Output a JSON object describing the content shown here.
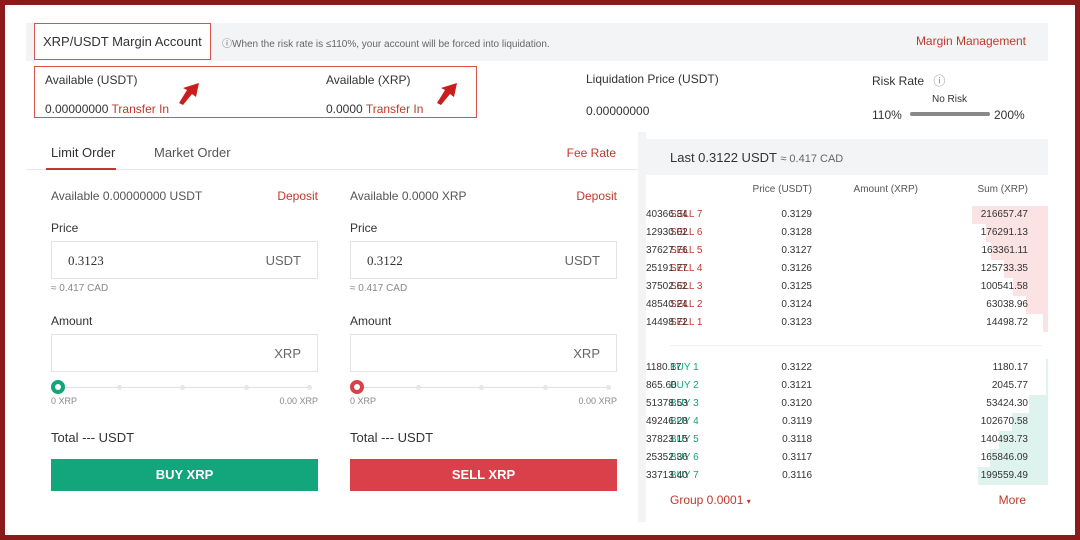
{
  "header": {
    "title": "XRP/USDT Margin Account",
    "warning": "When the risk rate is ≤110%, your account will be forced into liquidation.",
    "margin_management": "Margin Management"
  },
  "summary": {
    "available_usdt_label": "Available (USDT)",
    "available_usdt_value": "0.00000000",
    "available_xrp_label": "Available (XRP)",
    "available_xrp_value": "0.0000",
    "transfer_in": "Transfer In",
    "liquidation_label": "Liquidation Price (USDT)",
    "liquidation_value": "0.00000000",
    "risk_label": "Risk Rate",
    "risk_status": "No Risk",
    "risk_min": "110%",
    "risk_max": "200%"
  },
  "order_tabs": {
    "limit": "Limit Order",
    "market": "Market Order",
    "fee_rate": "Fee Rate"
  },
  "buy_form": {
    "available": "Available 0.00000000 USDT",
    "deposit": "Deposit",
    "price_label": "Price",
    "price_value": "0.3123",
    "price_unit": "USDT",
    "cad_equiv": "≈ 0.417 CAD",
    "amount_label": "Amount",
    "amount_unit": "XRP",
    "slider_min": "0 XRP",
    "slider_max": "0.00 XRP",
    "total": "Total --- USDT",
    "button": "BUY XRP"
  },
  "sell_form": {
    "available": "Available 0.0000 XRP",
    "deposit": "Deposit",
    "price_label": "Price",
    "price_value": "0.3122",
    "price_unit": "USDT",
    "cad_equiv": "≈ 0.417 CAD",
    "amount_label": "Amount",
    "amount_unit": "XRP",
    "slider_min": "0 XRP",
    "slider_max": "0.00 XRP",
    "total": "Total --- USDT",
    "button": "SELL XRP"
  },
  "orderbook": {
    "last": "Last 0.3122 USDT",
    "last_cad": "≈ 0.417 CAD",
    "col_price": "Price (USDT)",
    "col_amount": "Amount (XRP)",
    "col_sum": "Sum (XRP)",
    "max_sum": 216657.47,
    "sells": [
      {
        "side": "SELL 7",
        "price": "0.3129",
        "amount": "40366.34",
        "sum": "216657.47",
        "sum_value": 216657.47
      },
      {
        "side": "SELL 6",
        "price": "0.3128",
        "amount": "12930.02",
        "sum": "176291.13",
        "sum_value": 176291.13
      },
      {
        "side": "SELL 5",
        "price": "0.3127",
        "amount": "37627.76",
        "sum": "163361.11",
        "sum_value": 163361.11
      },
      {
        "side": "SELL 4",
        "price": "0.3126",
        "amount": "25191.77",
        "sum": "125733.35",
        "sum_value": 125733.35
      },
      {
        "side": "SELL 3",
        "price": "0.3125",
        "amount": "37502.62",
        "sum": "100541.58",
        "sum_value": 100541.58
      },
      {
        "side": "SELL 2",
        "price": "0.3124",
        "amount": "48540.24",
        "sum": "63038.96",
        "sum_value": 63038.96
      },
      {
        "side": "SELL 1",
        "price": "0.3123",
        "amount": "14498.72",
        "sum": "14498.72",
        "sum_value": 14498.72
      }
    ],
    "buys": [
      {
        "side": "BUY 1",
        "price": "0.3122",
        "amount": "1180.17",
        "sum": "1180.17",
        "sum_value": 1180.17
      },
      {
        "side": "BUY 2",
        "price": "0.3121",
        "amount": "865.60",
        "sum": "2045.77",
        "sum_value": 2045.77
      },
      {
        "side": "BUY 3",
        "price": "0.3120",
        "amount": "51378.53",
        "sum": "53424.30",
        "sum_value": 53424.3
      },
      {
        "side": "BUY 4",
        "price": "0.3119",
        "amount": "49246.28",
        "sum": "102670.58",
        "sum_value": 102670.58
      },
      {
        "side": "BUY 5",
        "price": "0.3118",
        "amount": "37823.15",
        "sum": "140493.73",
        "sum_value": 140493.73
      },
      {
        "side": "BUY 6",
        "price": "0.3117",
        "amount": "25352.36",
        "sum": "165846.09",
        "sum_value": 165846.09
      },
      {
        "side": "BUY 7",
        "price": "0.3116",
        "amount": "33713.40",
        "sum": "199559.49",
        "sum_value": 199559.49
      }
    ],
    "group": "Group 0.0001",
    "more": "More"
  },
  "colors": {
    "accent_red": "#c0392b",
    "buy_green": "#13a57b",
    "sell_red": "#d9404a",
    "sell_bar": "#fbe3e4",
    "buy_bar": "#dff3ee",
    "frame": "#8b1a1a"
  },
  "icons": {
    "info": "info-circle-icon",
    "arrow": "red-arrow-icon",
    "caret": "caret-down-icon"
  }
}
